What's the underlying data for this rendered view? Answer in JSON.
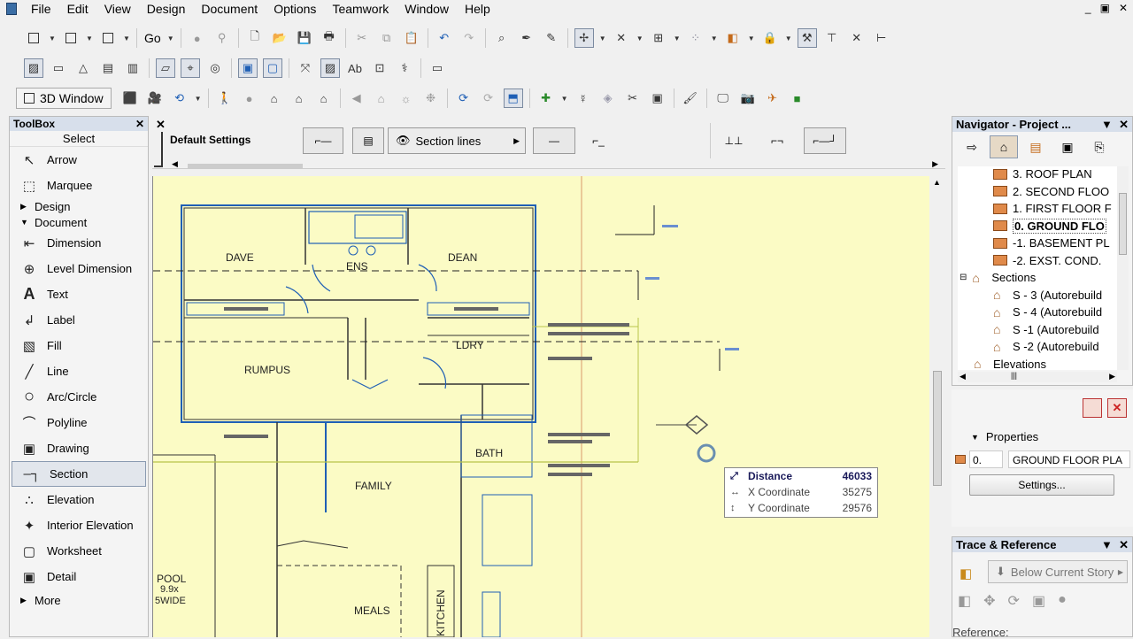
{
  "menu": [
    "File",
    "Edit",
    "View",
    "Design",
    "Document",
    "Options",
    "Teamwork",
    "Window",
    "Help"
  ],
  "window_controls": [
    "_",
    "▣",
    "✕"
  ],
  "toolbar": {
    "go_label": "Go",
    "window3d_label": "3D Window"
  },
  "toolbox": {
    "title": "ToolBox",
    "close": "✕",
    "select_label": "Select",
    "items_top": [
      {
        "label": "Arrow",
        "icon": "↖"
      },
      {
        "label": "Marquee",
        "icon": "⬚"
      }
    ],
    "design_group": "Design",
    "document_group": "Document",
    "items_document": [
      {
        "label": "Dimension",
        "icon": "⇤"
      },
      {
        "label": "Level Dimension",
        "icon": "⊕"
      },
      {
        "label": "Text",
        "icon": "A"
      },
      {
        "label": "Label",
        "icon": "↲"
      },
      {
        "label": "Fill",
        "icon": "▧"
      },
      {
        "label": "Line",
        "icon": "╱"
      },
      {
        "label": "Arc/Circle",
        "icon": "○"
      },
      {
        "label": "Polyline",
        "icon": "⌒"
      },
      {
        "label": "Drawing",
        "icon": "▣"
      },
      {
        "label": "Section",
        "icon": "–┐"
      },
      {
        "label": "Elevation",
        "icon": "∴"
      },
      {
        "label": "Interior Elevation",
        "icon": "✦"
      },
      {
        "label": "Worksheet",
        "icon": "▢"
      },
      {
        "label": "Detail",
        "icon": "▣"
      }
    ],
    "more_label": "More"
  },
  "infobox": {
    "close": "✕",
    "default_settings": "Default Settings",
    "section_lines": "Section lines"
  },
  "plan": {
    "rooms": [
      "DAVE",
      "ENS",
      "DEAN",
      "LDRY",
      "RUMPUS",
      "BATH",
      "FAMILY",
      "POOL",
      "9.9x",
      "5WIDE",
      "MEALS",
      "KITCHEN"
    ]
  },
  "coordinates": {
    "distance_label": "Distance",
    "distance_value": "46033",
    "x_label": "X Coordinate",
    "x_value": "35275",
    "y_label": "Y Coordinate",
    "y_value": "29576"
  },
  "navigator": {
    "title": "Navigator - Project ...",
    "stories": [
      "3. ROOF PLAN",
      "2. SECOND FLOO",
      "1. FIRST FLOOR F",
      "0. GROUND FLO",
      "-1. BASEMENT PL",
      "-2. EXST. COND."
    ],
    "sections_label": "Sections",
    "sections": [
      "S - 3 (Autorebuild",
      "S - 4 (Autorebuild",
      "S -1 (Autorebuild",
      "S -2 (Autorebuild"
    ],
    "elevations_label": "Elevations"
  },
  "properties": {
    "title": "Properties",
    "story_number": "0.",
    "story_name": "GROUND FLOOR PLA",
    "settings_button": "Settings..."
  },
  "trace": {
    "title": "Trace & Reference",
    "below_story": "Below Current Story",
    "reference_label": "Reference:"
  }
}
